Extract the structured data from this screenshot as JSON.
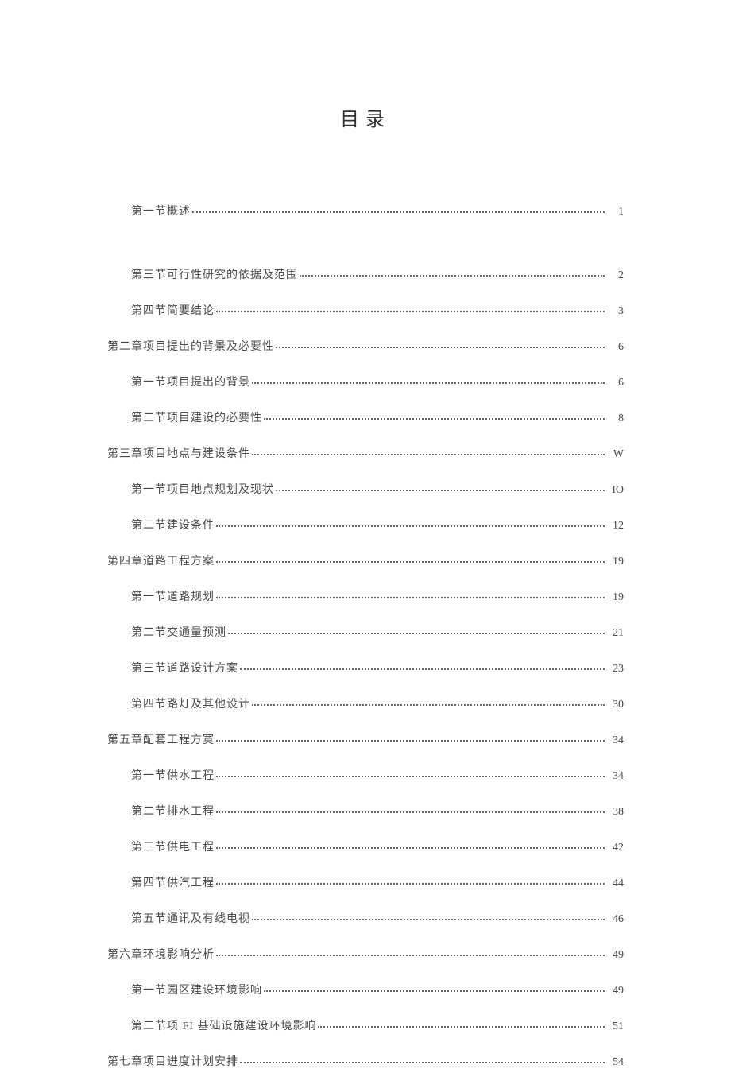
{
  "title": "目录",
  "toc": [
    {
      "level": 2,
      "label": "第一节概述",
      "page": "1",
      "first": true
    },
    {
      "level": 2,
      "label": "第三节可行性研究的依据及范围",
      "page": "2"
    },
    {
      "level": 2,
      "label": "第四节简要结论",
      "page": "3"
    },
    {
      "level": 1,
      "label": "第二章项目提出的背景及必要性 ",
      "page": "6"
    },
    {
      "level": 2,
      "label": "第一节项目提出的背景",
      "page": "6"
    },
    {
      "level": 2,
      "label": "第二节项目建设的必要性",
      "page": "8"
    },
    {
      "level": 1,
      "label": "第三章项目地点与建设条件 ",
      "page": "W"
    },
    {
      "level": 2,
      "label": "第一节项目地点规划及现状",
      "page": "IO"
    },
    {
      "level": 2,
      "label": "第二节建设条件",
      "page": "12"
    },
    {
      "level": 1,
      "label": "第四章道路工程方案 ",
      "page": "19"
    },
    {
      "level": 2,
      "label": "第一节道路规划",
      "page": "19"
    },
    {
      "level": 2,
      "label": "第二节交通量预测",
      "page": "21"
    },
    {
      "level": 2,
      "label": "第三节道路设计方案",
      "page": "23"
    },
    {
      "level": 2,
      "label": "第四节路灯及其他设计",
      "page": "30"
    },
    {
      "level": 1,
      "label": "第五章配套工程方寞 ",
      "page": "34"
    },
    {
      "level": 2,
      "label": "第一节供水工程",
      "page": "34"
    },
    {
      "level": 2,
      "label": "第二节排水工程",
      "page": "38"
    },
    {
      "level": 2,
      "label": "第三节供电工程",
      "page": " 42"
    },
    {
      "level": 2,
      "label": "第四节供汽工程",
      "page": "44"
    },
    {
      "level": 2,
      "label": "第五节通讯及有线电视",
      "page": "46"
    },
    {
      "level": 1,
      "label": "第六章环境影响分析 ",
      "page": "49"
    },
    {
      "level": 2,
      "label": "第一节园区建设环境影响",
      "page": "49"
    },
    {
      "level": 2,
      "label": "第二节项 FI 基础设施建设环境影响 ",
      "page": " 51"
    },
    {
      "level": 1,
      "label": "第七章项目进度计划安排 ",
      "page": "54"
    }
  ]
}
